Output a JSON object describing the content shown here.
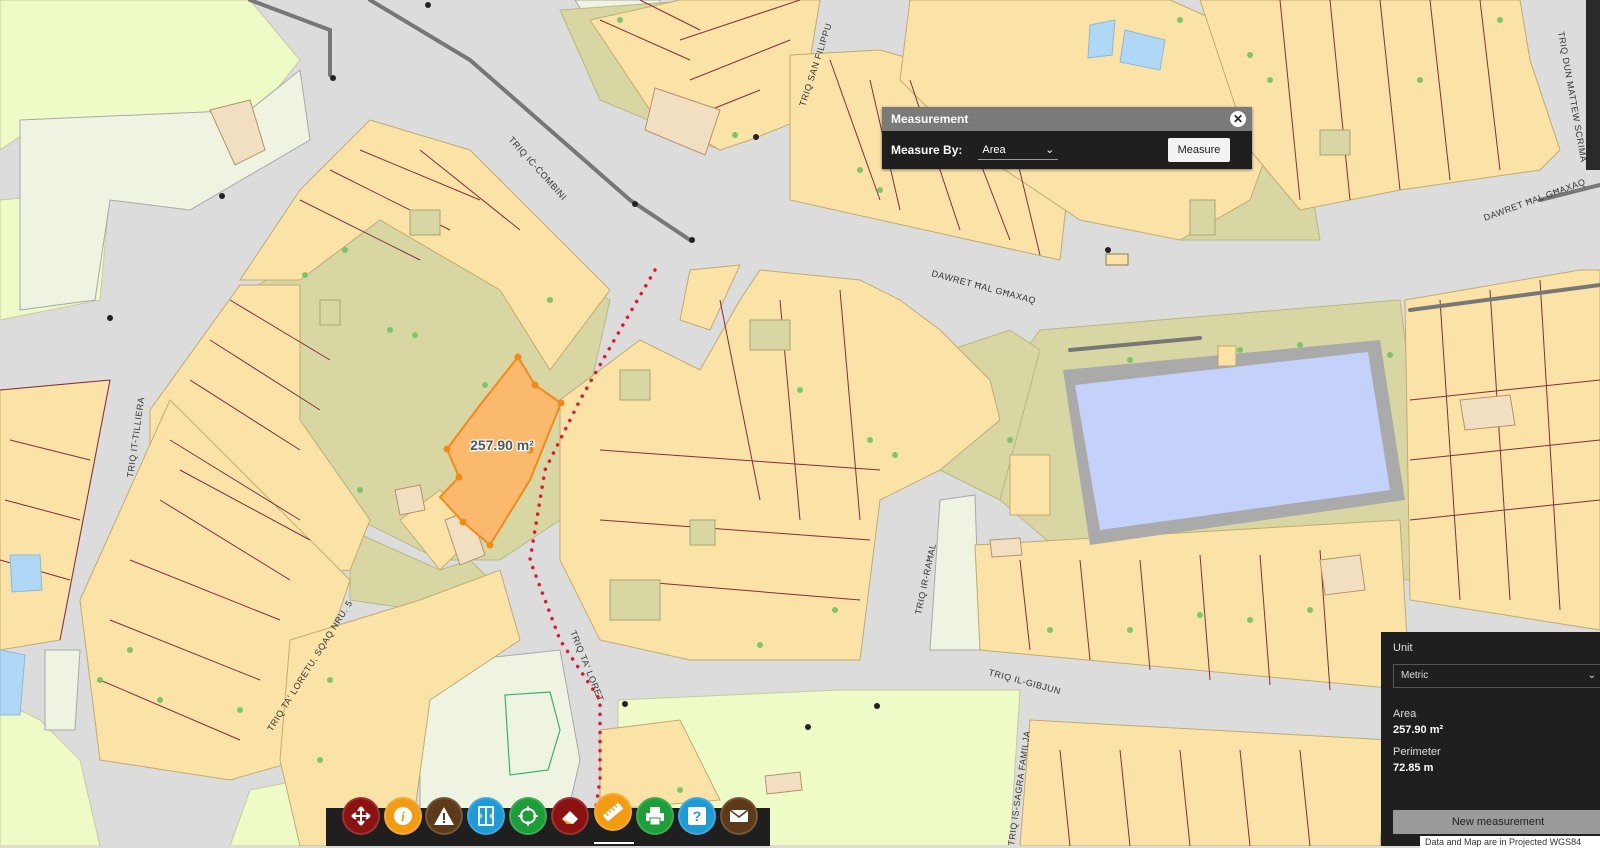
{
  "map": {
    "streets": {
      "combini": "TRIQ IĊ-ĊOMBINI",
      "filippu": "TRIQ SAN FILIPPU",
      "gmaxaq1": "DAWRET ĦAL GĦAXAQ",
      "gmaxaq2": "DAWRET ĦAL GĦAXAQ",
      "duminu": "TRIQ DUN MATTEW SCRIMA",
      "tilliera": "TRIQ IT-TILLIERA",
      "loretu": "TRIQ TA' LORETU, SQAQ NRU. 5",
      "taloret": "TRIQ TA' LORET",
      "rahal": "TRIQ IR-RAĦAL",
      "gibjun": "TRIQ IL-GIBJUN",
      "sagra": "TRIQ IS-SAGRA FAMILJA"
    },
    "measured_area_label": "257.90 m²",
    "colors": {
      "road": "#dcdcdc",
      "building": "#fbe3a8",
      "open_area": "#d8d7a3",
      "green_area": "#eefbc7",
      "reservoir": "#c3d1fb",
      "measure_fill": "#ffb668",
      "measure_stroke": "#f28a1a",
      "parcel_line": "#8a2b3c"
    }
  },
  "measurement_panel": {
    "title": "Measurement",
    "measure_by_label": "Measure By:",
    "measure_by_value": "Area",
    "measure_button": "Measure",
    "close_icon": "close-icon"
  },
  "results": {
    "unit_label": "Unit",
    "unit_value": "Metric",
    "area_label": "Area",
    "area_value": "257.90 m²",
    "perimeter_label": "Perimeter",
    "perimeter_value": "72.85 m",
    "new_button": "New measurement",
    "attribution": "Data and Map are in Projected WGS84"
  },
  "toolbar": {
    "buttons": [
      {
        "name": "home-icon",
        "color": "#8c1111"
      },
      {
        "name": "info-icon",
        "color": "#f39c12"
      },
      {
        "name": "warning-icon",
        "color": "#5d3a1a"
      },
      {
        "name": "swipe-icon",
        "color": "#1e9ad6"
      },
      {
        "name": "locate-icon",
        "color": "#1e9e38"
      },
      {
        "name": "eraser-icon",
        "color": "#8c1111"
      },
      {
        "name": "ruler-icon",
        "color": "#f39c12"
      },
      {
        "name": "print-icon",
        "color": "#1e9e38"
      },
      {
        "name": "help-icon",
        "color": "#1e9ad6"
      },
      {
        "name": "mail-icon",
        "color": "#5d3a1a"
      }
    ]
  }
}
